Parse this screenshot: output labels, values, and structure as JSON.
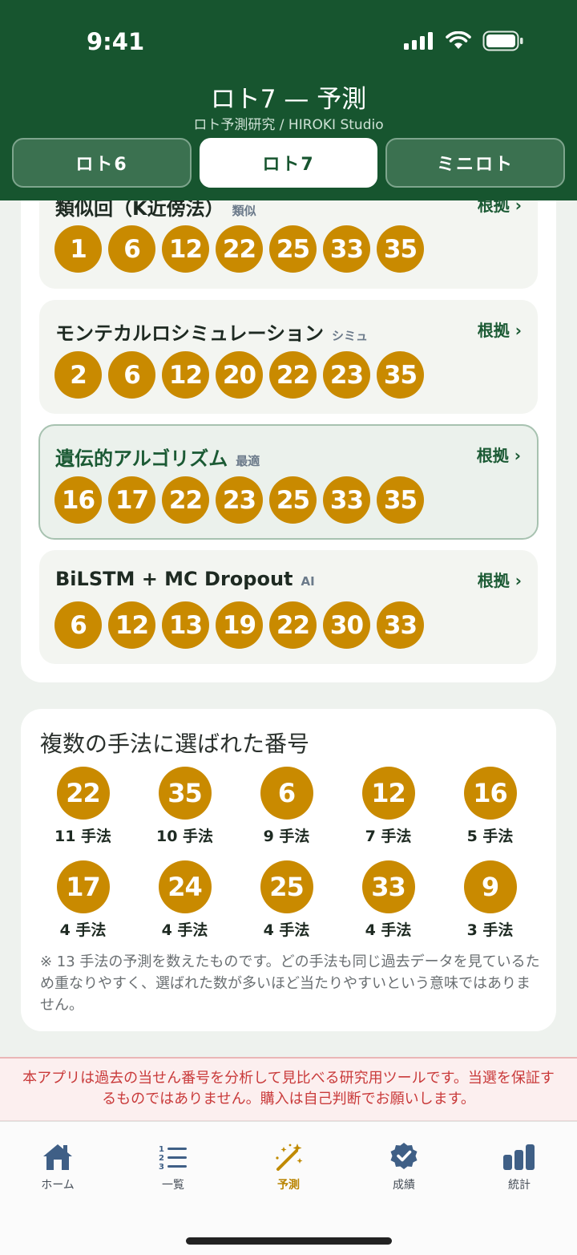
{
  "status": {
    "time": "9:41"
  },
  "header": {
    "title": "ロト7 — 予測",
    "subtitle": "ロト予測研究 / HIROKI Studio"
  },
  "tabs": [
    {
      "label": "ロト6"
    },
    {
      "label": "ロト7"
    },
    {
      "label": "ミニロト"
    }
  ],
  "methods": [
    {
      "name": "類似回（K近傍法）",
      "tag": "類似",
      "link": "根拠 ›",
      "numbers": [
        "1",
        "6",
        "12",
        "22",
        "25",
        "33",
        "35"
      ]
    },
    {
      "name": "モンテカルロシミュレーション",
      "tag": "シミュ",
      "link": "根拠 ›",
      "numbers": [
        "2",
        "6",
        "12",
        "20",
        "22",
        "23",
        "35"
      ]
    },
    {
      "name": "遺伝的アルゴリズム",
      "tag": "最適",
      "link": "根拠 ›",
      "numbers": [
        "16",
        "17",
        "22",
        "23",
        "25",
        "33",
        "35"
      ]
    },
    {
      "name": "BiLSTM + MC Dropout",
      "tag": "AI",
      "link": "根拠 ›",
      "numbers": [
        "6",
        "12",
        "13",
        "19",
        "22",
        "30",
        "33"
      ]
    }
  ],
  "multi": {
    "title": "複数の手法に選ばれた番号",
    "items": [
      {
        "number": "22",
        "count": "11 手法"
      },
      {
        "number": "35",
        "count": "10 手法"
      },
      {
        "number": "6",
        "count": "9 手法"
      },
      {
        "number": "12",
        "count": "7 手法"
      },
      {
        "number": "16",
        "count": "5 手法"
      },
      {
        "number": "17",
        "count": "4 手法"
      },
      {
        "number": "24",
        "count": "4 手法"
      },
      {
        "number": "25",
        "count": "4 手法"
      },
      {
        "number": "33",
        "count": "4 手法"
      },
      {
        "number": "9",
        "count": "3 手法"
      }
    ],
    "note": "※ 13 手法の予測を数えたものです。どの手法も同じ過去データを見ているため重なりやすく、選ばれた数が多いほど当たりやすいという意味ではありません。"
  },
  "disclaimer": "本アプリは過去の当せん番号を分析して見比べる研究用ツールです。当選を保証するものではありません。購入は自己判断でお願いします。",
  "nav": [
    {
      "label": "ホーム",
      "icon": "home-icon"
    },
    {
      "label": "一覧",
      "icon": "list-icon"
    },
    {
      "label": "予測",
      "icon": "magic-wand-icon"
    },
    {
      "label": "成績",
      "icon": "badge-check-icon"
    },
    {
      "label": "統計",
      "icon": "bar-chart-icon"
    }
  ],
  "colors": {
    "header": "#17552f",
    "ball": "#c98a00",
    "accent": "#b98400",
    "disclaimer_text": "#c93a3a"
  }
}
